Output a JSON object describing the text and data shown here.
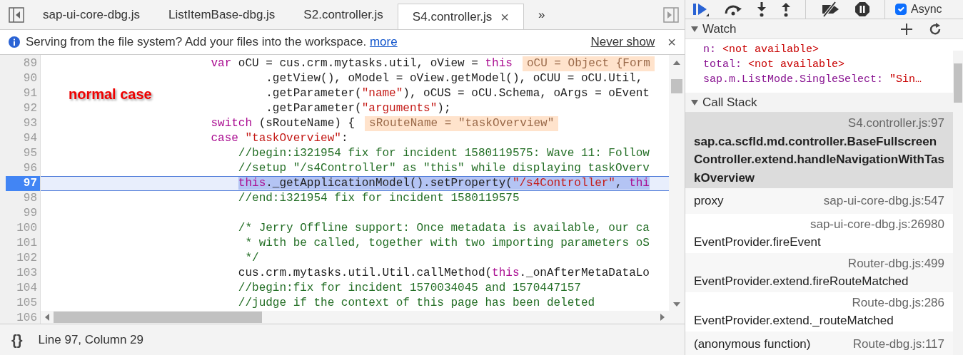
{
  "editor": {
    "tabs": [
      {
        "label": "sap-ui-core-dbg.js",
        "selected": false
      },
      {
        "label": "ListItemBase-dbg.js",
        "selected": false
      },
      {
        "label": "S2.controller.js",
        "selected": false
      },
      {
        "label": "S4.controller.js",
        "selected": true,
        "close": "×"
      }
    ],
    "overflow": "»",
    "infobar": {
      "text": "Serving from the file system? Add your files into the workspace.",
      "link": "more",
      "dismiss": "Never show",
      "close": "×"
    },
    "annotation": "normal case",
    "lines": [
      {
        "number": "89",
        "tokens": [
          {
            "kind": "kw",
            "text": "                        var"
          },
          {
            "kind": "plain",
            "text": " oCU = cus.crm.mytasks.util, oView = "
          },
          {
            "kind": "kw",
            "text": "this"
          }
        ],
        "inline_value": "oCU = Object {Form"
      },
      {
        "number": "90",
        "tokens": [
          {
            "kind": "plain",
            "text": "                                .getView(), oModel = oView.getModel(), oCUU = oCU.Util,"
          }
        ]
      },
      {
        "number": "91",
        "tokens": [
          {
            "kind": "plain",
            "text": "                                .getParameter("
          },
          {
            "kind": "str",
            "text": "\"name\""
          },
          {
            "kind": "plain",
            "text": "), oCUS = oCU.Schema, oArgs = oEvent"
          }
        ]
      },
      {
        "number": "92",
        "tokens": [
          {
            "kind": "plain",
            "text": "                                .getParameter("
          },
          {
            "kind": "str",
            "text": "\"arguments\""
          },
          {
            "kind": "plain",
            "text": ");"
          }
        ]
      },
      {
        "number": "93",
        "tokens": [
          {
            "kind": "kw",
            "text": "                        switch"
          },
          {
            "kind": "plain",
            "text": " (sRouteName) {"
          }
        ],
        "inline_value": "sRouteName = \"taskOverview\""
      },
      {
        "number": "94",
        "tokens": [
          {
            "kind": "kw",
            "text": "                        case"
          },
          {
            "kind": "str",
            "text": " \"taskOverview\""
          },
          {
            "kind": "plain",
            "text": ":"
          }
        ]
      },
      {
        "number": "95",
        "tokens": [
          {
            "kind": "cmt",
            "text": "                            //begin:i321954 fix for incident 1580119575: Wave 11: Follow"
          }
        ]
      },
      {
        "number": "96",
        "tokens": [
          {
            "kind": "cmt",
            "text": "                            //setup \"/s4Controller\" as \"this\" while displaying taskOverv"
          }
        ]
      },
      {
        "number": "97",
        "current": true,
        "tokens": [
          {
            "kind": "kw",
            "text": "                            this"
          },
          {
            "kind": "plain",
            "text": "._getApplicationModel().setProperty("
          },
          {
            "kind": "str",
            "text": "\"/s4Controller\""
          },
          {
            "kind": "plain",
            "text": ", "
          },
          {
            "kind": "kw",
            "text": "thi"
          }
        ]
      },
      {
        "number": "98",
        "tokens": [
          {
            "kind": "cmt",
            "text": "                            //end:i321954 fix for incident 1580119575"
          }
        ]
      },
      {
        "number": "99"
      },
      {
        "number": "100",
        "tokens": [
          {
            "kind": "cmt",
            "text": "                            /* Jerry Offline support: Once metadata is available, our ca"
          }
        ]
      },
      {
        "number": "101",
        "tokens": [
          {
            "kind": "cmt",
            "text": "                             * with be called, together with two importing parameters oS"
          }
        ]
      },
      {
        "number": "102",
        "tokens": [
          {
            "kind": "cmt",
            "text": "                             */"
          }
        ]
      },
      {
        "number": "103",
        "tokens": [
          {
            "kind": "plain",
            "text": "                            cus.crm.mytasks.util.Util.callMethod("
          },
          {
            "kind": "kw",
            "text": "this"
          },
          {
            "kind": "plain",
            "text": "._onAfterMetaDataLo"
          }
        ]
      },
      {
        "number": "104",
        "tokens": [
          {
            "kind": "cmt",
            "text": "                            //begin:fix for incident 1570034045 and 1570447157"
          }
        ]
      },
      {
        "number": "105",
        "tokens": [
          {
            "kind": "cmt",
            "text": "                            //judge if the context of this page has been deleted"
          }
        ]
      },
      {
        "number": "106"
      }
    ],
    "status_bar": {
      "pretty_print": "{}",
      "position": "Line 97, Column 29"
    }
  },
  "debugger": {
    "async": {
      "label": "Async",
      "checked": true
    },
    "watch": {
      "title": "Watch",
      "expanded": true,
      "items": [
        {
          "name": "n:",
          "value": "<not available>"
        },
        {
          "name": "total:",
          "value": "<not available>"
        },
        {
          "name": "sap.m.ListMode.SingleSelect:",
          "value": "\"Sin…"
        }
      ]
    },
    "call_stack": {
      "title": "Call Stack",
      "expanded": true,
      "frames": [
        {
          "kind": "two-line",
          "function": "sap.ca.scfld.md.controller.BaseFullscreenController.extend.handleNavigationWithTaskOverview",
          "location": "S4.controller.js:97",
          "selected": true
        },
        {
          "kind": "one-line",
          "function": "proxy",
          "location": "sap-ui-core-dbg.js:547",
          "selected": false
        },
        {
          "kind": "two-line",
          "function": "EventProvider.fireEvent",
          "location": "sap-ui-core-dbg.js:26980",
          "selected": false
        },
        {
          "kind": "two-line",
          "function": "EventProvider.extend.fireRouteMatched",
          "location": "Router-dbg.js:499",
          "selected": false
        },
        {
          "kind": "two-line",
          "function": "EventProvider.extend._routeMatched",
          "location": "Route-dbg.js:286",
          "selected": false
        },
        {
          "kind": "one-line",
          "function": "(anonymous function)",
          "location": "Route-dbg.js:117",
          "selected": false
        }
      ]
    }
  }
}
